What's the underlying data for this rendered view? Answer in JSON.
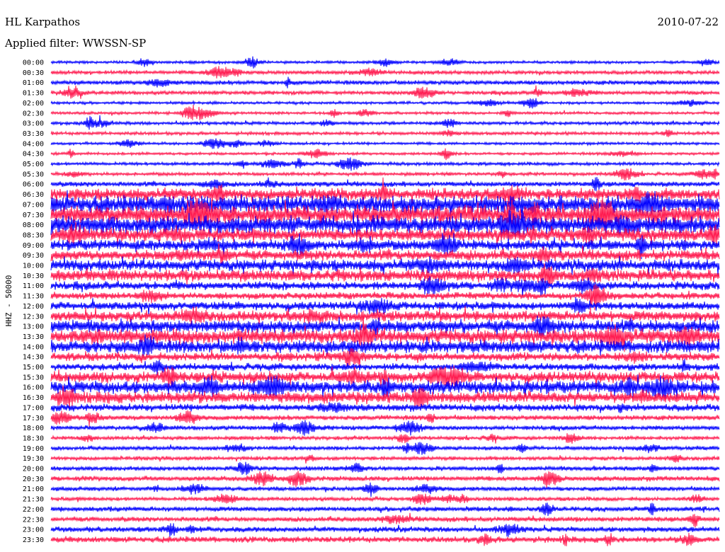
{
  "header": {
    "station": "HL Karpathos",
    "date": "2010-07-22",
    "filter": "Applied filter: WWSSN-SP"
  },
  "chart_data": {
    "type": "line",
    "title": "HL Karpathos",
    "subtitle": "Applied filter: WWSSN-SP",
    "ylabel": "HHZ - 50000",
    "date": "2010-07-22",
    "trace_colors": [
      "#0000ff",
      "#ff1a4f"
    ],
    "rows": [
      {
        "time": "00:00",
        "activity": 0.1
      },
      {
        "time": "00:30",
        "activity": 0.2
      },
      {
        "time": "01:00",
        "activity": 0.25
      },
      {
        "time": "01:30",
        "activity": 0.2
      },
      {
        "time": "02:00",
        "activity": 0.1
      },
      {
        "time": "02:30",
        "activity": 0.1
      },
      {
        "time": "03:00",
        "activity": 0.15
      },
      {
        "time": "03:30",
        "activity": 0.15
      },
      {
        "time": "04:00",
        "activity": 0.1
      },
      {
        "time": "04:30",
        "activity": 0.1
      },
      {
        "time": "05:00",
        "activity": 0.15
      },
      {
        "time": "05:30",
        "activity": 0.15
      },
      {
        "time": "06:00",
        "activity": 0.3
      },
      {
        "time": "06:30",
        "activity": 0.9
      },
      {
        "time": "07:00",
        "activity": 1.4
      },
      {
        "time": "07:30",
        "activity": 1.5
      },
      {
        "time": "08:00",
        "activity": 1.4
      },
      {
        "time": "08:30",
        "activity": 1.0
      },
      {
        "time": "09:00",
        "activity": 0.8
      },
      {
        "time": "09:30",
        "activity": 0.8
      },
      {
        "time": "10:00",
        "activity": 0.9
      },
      {
        "time": "10:30",
        "activity": 0.9
      },
      {
        "time": "11:00",
        "activity": 0.6
      },
      {
        "time": "11:30",
        "activity": 0.5
      },
      {
        "time": "12:00",
        "activity": 0.6
      },
      {
        "time": "12:30",
        "activity": 0.8
      },
      {
        "time": "13:00",
        "activity": 1.0
      },
      {
        "time": "13:30",
        "activity": 1.1
      },
      {
        "time": "14:00",
        "activity": 1.0
      },
      {
        "time": "14:30",
        "activity": 0.6
      },
      {
        "time": "15:00",
        "activity": 0.5
      },
      {
        "time": "15:30",
        "activity": 0.8
      },
      {
        "time": "16:00",
        "activity": 1.0
      },
      {
        "time": "16:30",
        "activity": 0.9
      },
      {
        "time": "17:00",
        "activity": 0.5
      },
      {
        "time": "17:30",
        "activity": 0.3
      },
      {
        "time": "18:00",
        "activity": 0.25
      },
      {
        "time": "18:30",
        "activity": 0.2
      },
      {
        "time": "19:00",
        "activity": 0.2
      },
      {
        "time": "19:30",
        "activity": 0.2
      },
      {
        "time": "20:00",
        "activity": 0.25
      },
      {
        "time": "20:30",
        "activity": 0.3
      },
      {
        "time": "21:00",
        "activity": 0.25
      },
      {
        "time": "21:30",
        "activity": 0.2
      },
      {
        "time": "22:00",
        "activity": 0.3
      },
      {
        "time": "22:30",
        "activity": 0.3
      },
      {
        "time": "23:00",
        "activity": 0.35
      },
      {
        "time": "23:30",
        "activity": 0.4
      }
    ]
  }
}
